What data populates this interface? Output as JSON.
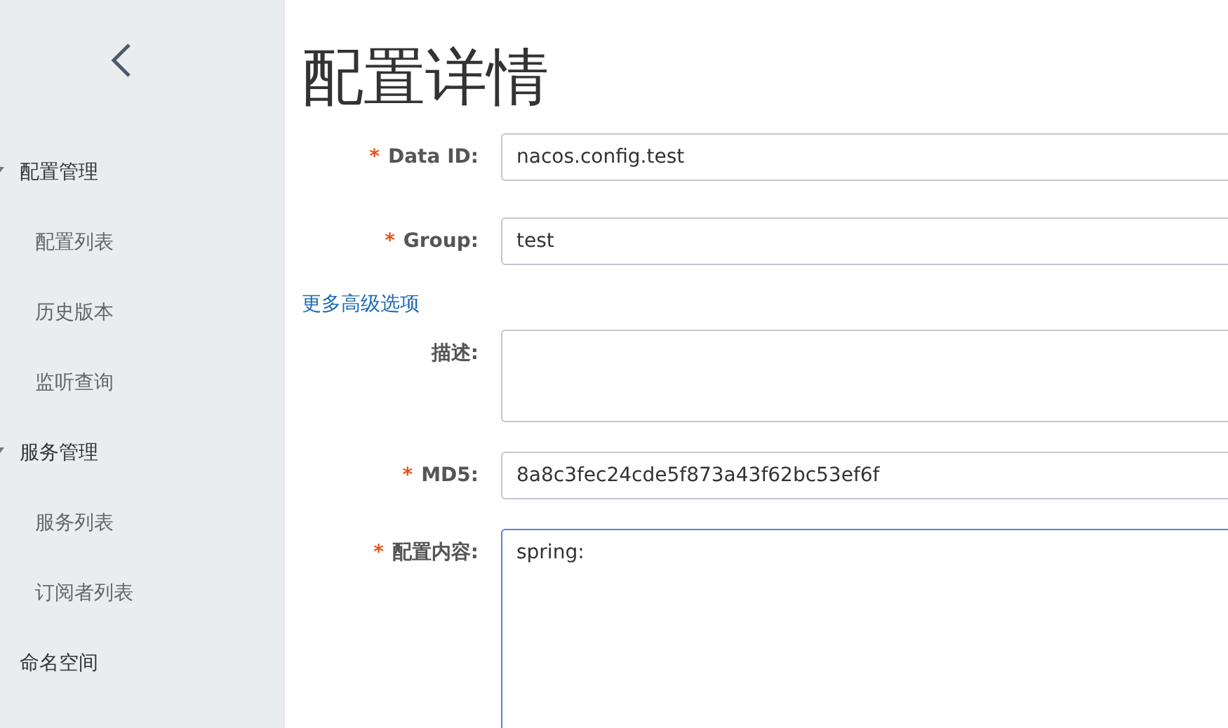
{
  "sidebar": {
    "items": [
      {
        "label": "配置管理",
        "expanded": true,
        "children": [
          {
            "label": "配置列表"
          },
          {
            "label": "历史版本"
          },
          {
            "label": "监听查询"
          }
        ]
      },
      {
        "label": "服务管理",
        "expanded": true,
        "children": [
          {
            "label": "服务列表"
          },
          {
            "label": "订阅者列表"
          }
        ]
      },
      {
        "label": "命名空间"
      }
    ]
  },
  "page": {
    "title": "配置详情"
  },
  "form": {
    "fields": [
      {
        "kind": "input",
        "label": "Data ID:",
        "required_mark": "*",
        "value": "nacos.config.test"
      },
      {
        "kind": "input",
        "label": "Group:",
        "required_mark": "*",
        "value": "test"
      },
      {
        "kind": "link",
        "label": "更多高级选项"
      },
      {
        "kind": "textarea",
        "label": "描述:"
      },
      {
        "kind": "input",
        "label": "MD5:",
        "required_mark": "*",
        "value": "8a8c3fec24cde5f873a43f62bc53ef6f"
      },
      {
        "kind": "editor",
        "label": "配置内容:",
        "required_mark": "*",
        "value": "spring:",
        "focused": true
      }
    ]
  }
}
